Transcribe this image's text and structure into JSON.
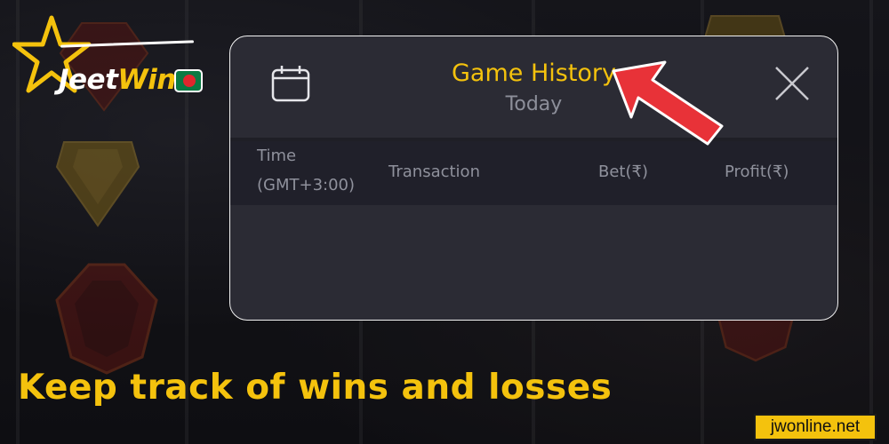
{
  "brand": {
    "logo_part1": "Jeet",
    "logo_part2": "Win"
  },
  "modal": {
    "title": "Game History",
    "subtitle": "Today",
    "calendar_icon": "calendar-icon",
    "close_icon": "close-icon",
    "columns": {
      "time_line1": "Time",
      "time_line2": "(GMT+3:00)",
      "transaction": "Transaction",
      "bet": "Bet(₹)",
      "profit": "Profit(₹)"
    }
  },
  "caption": "Keep track of wins and losses",
  "site": "jwonline.net",
  "colors": {
    "accent": "#f4c20d",
    "modal_bg": "#2b2b34",
    "arrow": "#e83238"
  }
}
